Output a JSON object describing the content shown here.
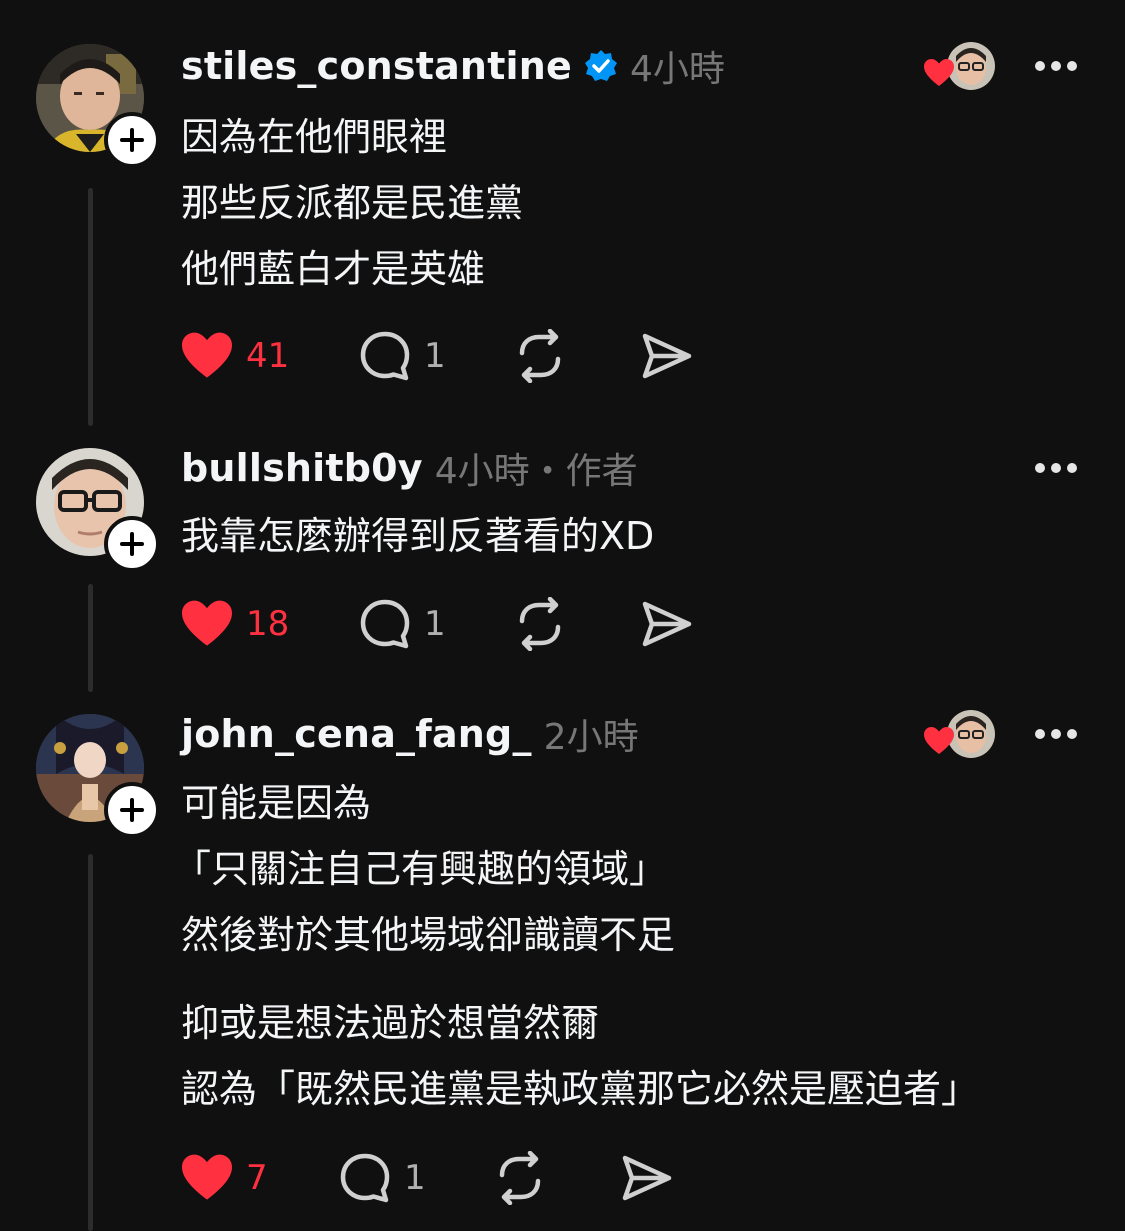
{
  "theme": {
    "background": "#101010",
    "text": "#f3f5f7",
    "muted": "#777777",
    "like_red": "#ff3040",
    "verified_blue": "#0095f6"
  },
  "posts": [
    {
      "username": "stiles_constantine",
      "verified": true,
      "meta": "4小時",
      "liked_by_author": true,
      "lines": [
        "因為在他們眼裡",
        "那些反派都是民進黨",
        "他們藍白才是英雄"
      ],
      "likes": "41",
      "replies": "1",
      "liked": true
    },
    {
      "username": "bullshitb0y",
      "verified": false,
      "meta": "4小時・作者",
      "liked_by_author": false,
      "lines": [
        "我靠怎麼辦得到反著看的XD"
      ],
      "likes": "18",
      "replies": "1",
      "liked": true
    },
    {
      "username": "john_cena_fang_",
      "verified": false,
      "meta": "2小時",
      "liked_by_author": true,
      "lines": [
        "可能是因為",
        "「只關注自己有興趣的領域」",
        "然後對於其他場域卻識讀不足",
        "",
        "抑或是想法過於想當然爾",
        "認為「既然民進黨是執政黨那它必然是壓迫者」"
      ],
      "likes": "7",
      "replies": "1",
      "liked": true
    }
  ],
  "icons": {
    "follow": "plus-icon",
    "verified": "verified-badge-icon",
    "like": "heart-filled-icon",
    "reply": "speech-bubble-icon",
    "repost": "repost-icon",
    "share": "send-icon",
    "more": "more-dots-icon"
  }
}
